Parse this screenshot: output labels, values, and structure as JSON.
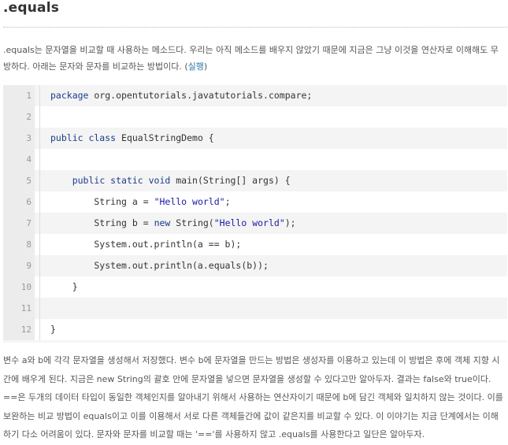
{
  "section": {
    "title": ".equals"
  },
  "intro": {
    "text": ".equals는 문자열을 비교할 때 사용하는 메소드다. 우리는 아직 메소드를 배우지 않았기 때문에 지금은 그냥 이것을 연산자로 이해해도 무방하다. 아래는 문자와 문자를 비교하는 방법이다. (",
    "link_label": "실행",
    "text_end": ")"
  },
  "code": {
    "lines": [
      {
        "num": "1",
        "segments": [
          {
            "t": "kw",
            "v": "package"
          },
          {
            "t": "plain",
            "v": " org.opentutorials.javatutorials.compare;"
          }
        ]
      },
      {
        "num": "2",
        "segments": []
      },
      {
        "num": "3",
        "segments": [
          {
            "t": "kw",
            "v": "public class"
          },
          {
            "t": "plain",
            "v": " EqualStringDemo {"
          }
        ]
      },
      {
        "num": "4",
        "segments": []
      },
      {
        "num": "5",
        "segments": [
          {
            "t": "plain",
            "v": "    "
          },
          {
            "t": "kw",
            "v": "public static void"
          },
          {
            "t": "plain",
            "v": " main(String[] args) {"
          }
        ]
      },
      {
        "num": "6",
        "segments": [
          {
            "t": "plain",
            "v": "        String a = "
          },
          {
            "t": "str",
            "v": "\"Hello world\""
          },
          {
            "t": "plain",
            "v": ";"
          }
        ]
      },
      {
        "num": "7",
        "segments": [
          {
            "t": "plain",
            "v": "        String b = "
          },
          {
            "t": "kw",
            "v": "new"
          },
          {
            "t": "plain",
            "v": " String("
          },
          {
            "t": "str",
            "v": "\"Hello world\""
          },
          {
            "t": "plain",
            "v": ");"
          }
        ]
      },
      {
        "num": "8",
        "segments": [
          {
            "t": "plain",
            "v": "        System.out.println(a == b);"
          }
        ]
      },
      {
        "num": "9",
        "segments": [
          {
            "t": "plain",
            "v": "        System.out.println(a.equals(b));"
          }
        ]
      },
      {
        "num": "10",
        "segments": [
          {
            "t": "plain",
            "v": "    }"
          }
        ]
      },
      {
        "num": "11",
        "segments": []
      },
      {
        "num": "12",
        "segments": [
          {
            "t": "plain",
            "v": "}"
          }
        ]
      }
    ]
  },
  "outro": {
    "text": "변수 a와 b에 각각 문자열을 생성해서 저장했다. 변수 b에 문자열을 만드는 방법은 생성자를 이용하고 있는데 이 방법은 후에 객체 지향 시간에 배우게 된다. 지금은 new String의 괄호 안에 문자열을 넣으면 문자열을 생성할 수 있다고만 알아두자. 결과는 false와 true이다. ==은 두개의 데이터 타입이 동일한 객체인지를 알아내기 위해서 사용하는 연산자이기 때문에 b에 담긴 객체와 일치하지 않는 것이다. 이를 보완하는 비교 방법이 equals이고 이를 이용해서 서로 다른 객체들간에 값이 같은지를 비교할 수 있다. 이 이야기는 지금 단계에서는 이해하기 다소 어려움이 있다. 문자와 문자를 비교할 때는 '=='를 사용하지 않고 .equals를 사용한다고 일단은 알아두자."
  },
  "colors": {
    "keyword": "#1a3b8c",
    "string": "#1a1aa6",
    "link": "#2a7ab0",
    "body_text": "#555555"
  }
}
